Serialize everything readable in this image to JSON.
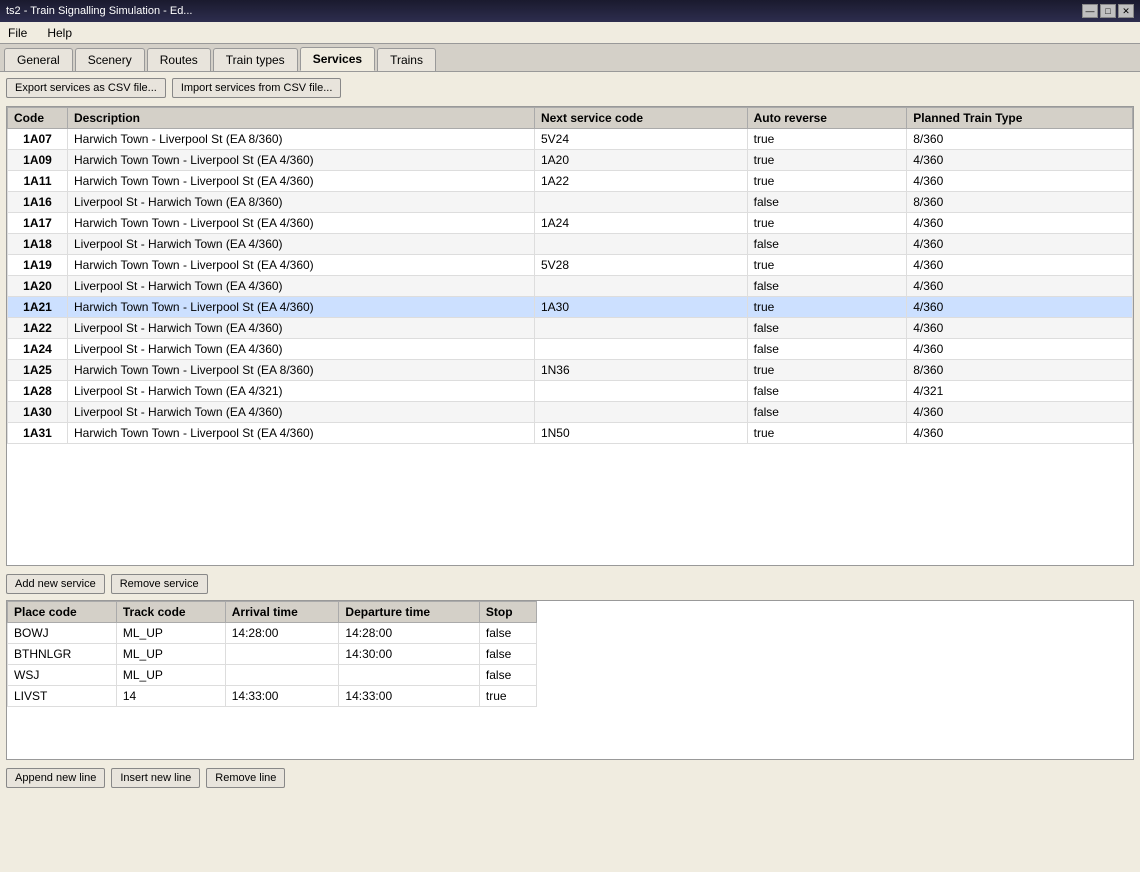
{
  "window": {
    "title": "ts2 - Train Signalling Simulation - Ed...",
    "minimize": "—",
    "maximize": "□",
    "close": "✕"
  },
  "menu": {
    "file": "File",
    "help": "Help"
  },
  "tabs": [
    {
      "id": "general",
      "label": "General"
    },
    {
      "id": "scenery",
      "label": "Scenery"
    },
    {
      "id": "routes",
      "label": "Routes"
    },
    {
      "id": "train-types",
      "label": "Train types"
    },
    {
      "id": "services",
      "label": "Services"
    },
    {
      "id": "trains",
      "label": "Trains"
    }
  ],
  "toolbar": {
    "export_btn": "Export services as CSV file...",
    "import_btn": "Import services from CSV file..."
  },
  "services_table": {
    "headers": [
      "Code",
      "Description",
      "Next service code",
      "Auto reverse",
      "Planned Train Type"
    ],
    "rows": [
      {
        "code": "1A07",
        "description": "Harwich Town - Liverpool St (EA 8/360)",
        "next": "5V24",
        "auto_reverse": "true",
        "train_type": "8/360"
      },
      {
        "code": "1A09",
        "description": "Harwich Town Town - Liverpool St (EA 4/360)",
        "next": "1A20",
        "auto_reverse": "true",
        "train_type": "4/360"
      },
      {
        "code": "1A11",
        "description": "Harwich Town Town - Liverpool St (EA 4/360)",
        "next": "1A22",
        "auto_reverse": "true",
        "train_type": "4/360"
      },
      {
        "code": "1A16",
        "description": "Liverpool St - Harwich Town (EA 8/360)",
        "next": "",
        "auto_reverse": "false",
        "train_type": "8/360"
      },
      {
        "code": "1A17",
        "description": "Harwich Town Town - Liverpool St (EA 4/360)",
        "next": "1A24",
        "auto_reverse": "true",
        "train_type": "4/360"
      },
      {
        "code": "1A18",
        "description": "Liverpool St - Harwich Town (EA 4/360)",
        "next": "",
        "auto_reverse": "false",
        "train_type": "4/360"
      },
      {
        "code": "1A19",
        "description": "Harwich Town Town - Liverpool St (EA 4/360)",
        "next": "5V28",
        "auto_reverse": "true",
        "train_type": "4/360"
      },
      {
        "code": "1A20",
        "description": "Liverpool St - Harwich Town (EA 4/360)",
        "next": "",
        "auto_reverse": "false",
        "train_type": "4/360"
      },
      {
        "code": "1A21",
        "description": "Harwich Town Town - Liverpool St (EA 4/360)",
        "next": "1A30",
        "auto_reverse": "true",
        "train_type": "4/360",
        "selected": true
      },
      {
        "code": "1A22",
        "description": "Liverpool St - Harwich Town (EA 4/360)",
        "next": "",
        "auto_reverse": "false",
        "train_type": "4/360"
      },
      {
        "code": "1A24",
        "description": "Liverpool St - Harwich Town (EA 4/360)",
        "next": "",
        "auto_reverse": "false",
        "train_type": "4/360"
      },
      {
        "code": "1A25",
        "description": "Harwich Town Town - Liverpool St (EA 8/360)",
        "next": "1N36",
        "auto_reverse": "true",
        "train_type": "8/360"
      },
      {
        "code": "1A28",
        "description": "Liverpool St - Harwich Town (EA 4/321)",
        "next": "",
        "auto_reverse": "false",
        "train_type": "4/321"
      },
      {
        "code": "1A30",
        "description": "Liverpool St - Harwich Town (EA 4/360)",
        "next": "",
        "auto_reverse": "false",
        "train_type": "4/360"
      },
      {
        "code": "1A31",
        "description": "Harwich Town Town - Liverpool St (EA 4/360)",
        "next": "1N50",
        "auto_reverse": "true",
        "train_type": "4/360"
      }
    ]
  },
  "service_buttons": {
    "add": "Add new service",
    "remove": "Remove service"
  },
  "detail_table": {
    "headers": [
      "Place code",
      "Track code",
      "Arrival time",
      "Departure time",
      "Stop"
    ],
    "rows": [
      {
        "place_code": "BOWJ",
        "track_code": "ML_UP",
        "arrival": "14:28:00",
        "departure": "14:28:00",
        "stop": "false"
      },
      {
        "place_code": "BTHNLGR",
        "track_code": "ML_UP",
        "arrival": "",
        "departure": "14:30:00",
        "stop": "false"
      },
      {
        "place_code": "WSJ",
        "track_code": "ML_UP",
        "arrival": "",
        "departure": "",
        "stop": "false"
      },
      {
        "place_code": "LIVST",
        "track_code": "14",
        "arrival": "14:33:00",
        "departure": "14:33:00",
        "stop": "true"
      }
    ]
  },
  "line_buttons": {
    "append": "Append new line",
    "insert": "Insert new line",
    "remove": "Remove line"
  }
}
